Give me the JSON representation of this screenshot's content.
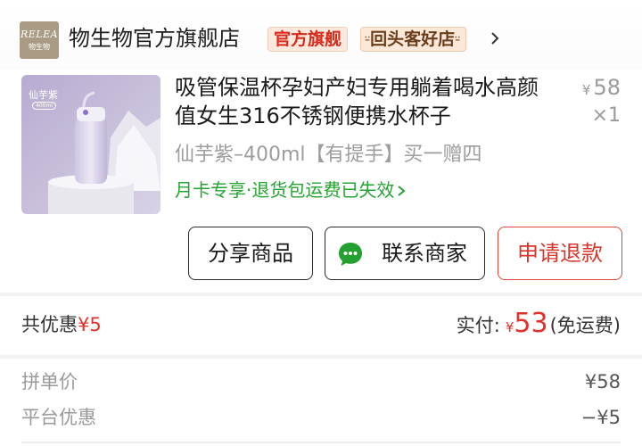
{
  "store": {
    "logo_text": "RELEA",
    "logo_sub": "物生物",
    "name": "物生物官方旗舰店",
    "badge_flagship": "官方旗舰",
    "badge_repeat_mark": "⸚",
    "badge_repeat": "回头客好店",
    "badge_repeat_tail": "⸚",
    "icon": "chevron-right-icon"
  },
  "product": {
    "image_caption": "仙芋紫",
    "image_sub": "400ml",
    "title": "吸管保温杯孕妇产妇专用躺着喝水高颜值女生316不锈钢便携水杯子",
    "price_symbol": "¥",
    "price": "58",
    "quantity": "×1",
    "variant": "仙芋紫–400ml【有提手】买一赠四",
    "service": "月卡专享·退货包运费已失效",
    "service_color": "#25a331"
  },
  "actions": {
    "share": "分享商品",
    "contact": "联系商家",
    "refund": "申请退款",
    "refund_color": "#d8342b",
    "contact_icon": "chat-bubble-icon"
  },
  "summary": {
    "discount_label": "共优惠",
    "discount_value": "¥5",
    "paid_label": "实付:",
    "paid_currency": "¥",
    "paid_amount": "53",
    "shipping": "(免运费)",
    "accent_color": "#e0312a"
  },
  "breakdown": {
    "rows": [
      {
        "label": "拼单价",
        "value": "¥58"
      },
      {
        "label": "平台优惠",
        "value": "−¥5"
      }
    ]
  }
}
